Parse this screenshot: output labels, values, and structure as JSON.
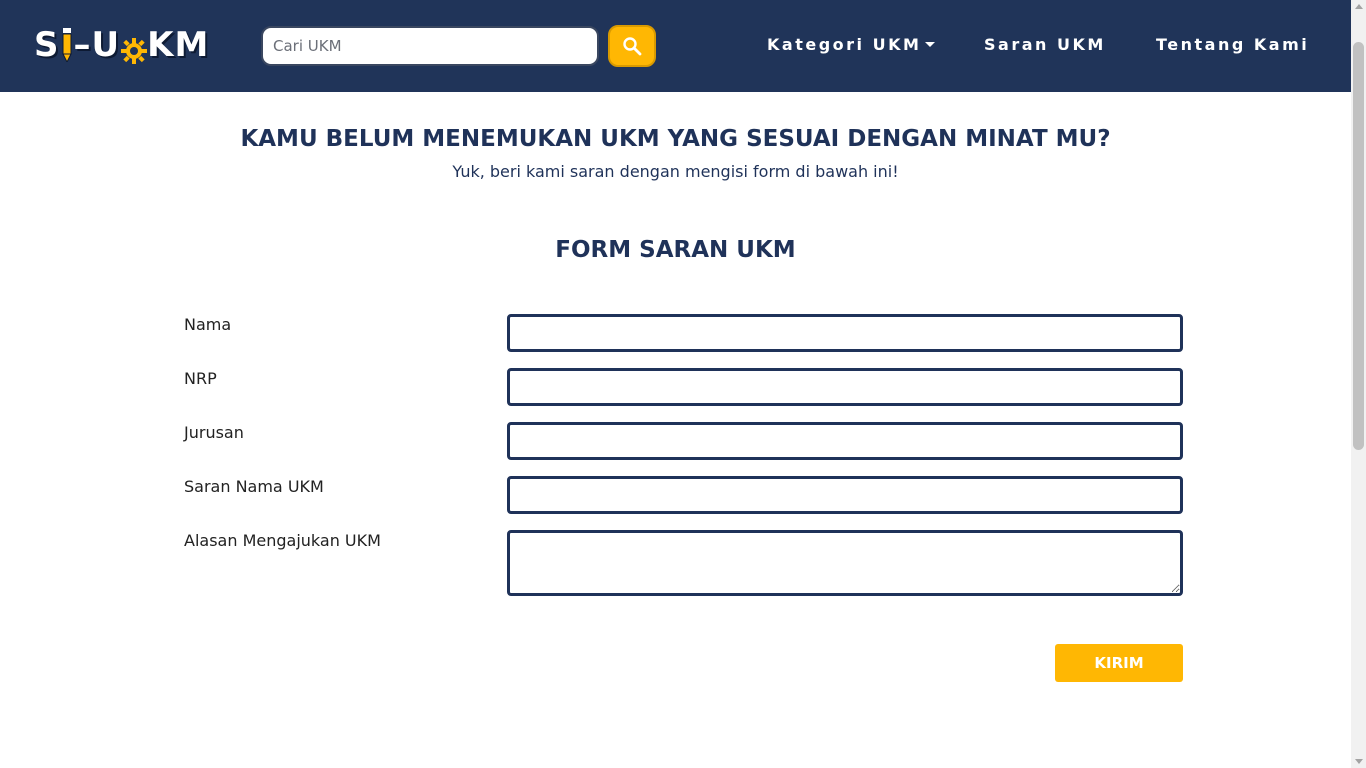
{
  "navbar": {
    "logo": {
      "text_1": "S",
      "text_2": "–U",
      "text_3": "KM"
    },
    "search": {
      "placeholder": "Cari UKM",
      "value": "",
      "icon": "search-icon"
    },
    "links": {
      "kategori": "Kategori UKM",
      "saran": "Saran UKM",
      "tentang": "Tentang Kami"
    }
  },
  "intro": {
    "headline": "KAMU BELUM MENEMUKAN UKM YANG SESUAI DENGAN MINAT MU?",
    "subline": "Yuk, beri kami saran dengan mengisi form di bawah ini!"
  },
  "form": {
    "title": "FORM SARAN UKM",
    "fields": {
      "nama": {
        "label": "Nama",
        "value": ""
      },
      "nrp": {
        "label": "NRP",
        "value": ""
      },
      "jurusan": {
        "label": "Jurusan",
        "value": ""
      },
      "saran_nama": {
        "label": "Saran Nama UKM",
        "value": ""
      },
      "alasan": {
        "label": "Alasan Mengajukan UKM",
        "value": ""
      }
    },
    "submit_label": "KIRIM"
  },
  "colors": {
    "navbar_bg": "#203459",
    "accent": "#ffb703",
    "text_primary": "#1f3259"
  }
}
